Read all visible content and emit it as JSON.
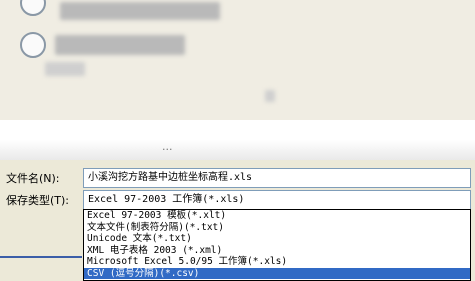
{
  "dialog": {
    "filename_label": "文件名(N):",
    "filename_value": "小溪沟挖方路基中边桩坐标高程.xls",
    "filetype_label": "保存类型(T):",
    "filetype_selected": "Excel 97-2003 工作簿(*.xls)",
    "filetype_options": [
      "Excel 97-2003 模板(*.xlt)",
      "文本文件(制表符分隔)(*.txt)",
      "Unicode 文本(*.txt)",
      "XML 电子表格 2003 (*.xml)",
      "Microsoft Excel 5.0/95 工作簿(*.xls)",
      "CSV (逗号分隔)(*.csv)"
    ],
    "highlighted_option_index": 5,
    "ellipsis": "..."
  },
  "colors": {
    "selection": "#316ac5",
    "input_border": "#7f9db9",
    "panel": "#ece9d8"
  }
}
